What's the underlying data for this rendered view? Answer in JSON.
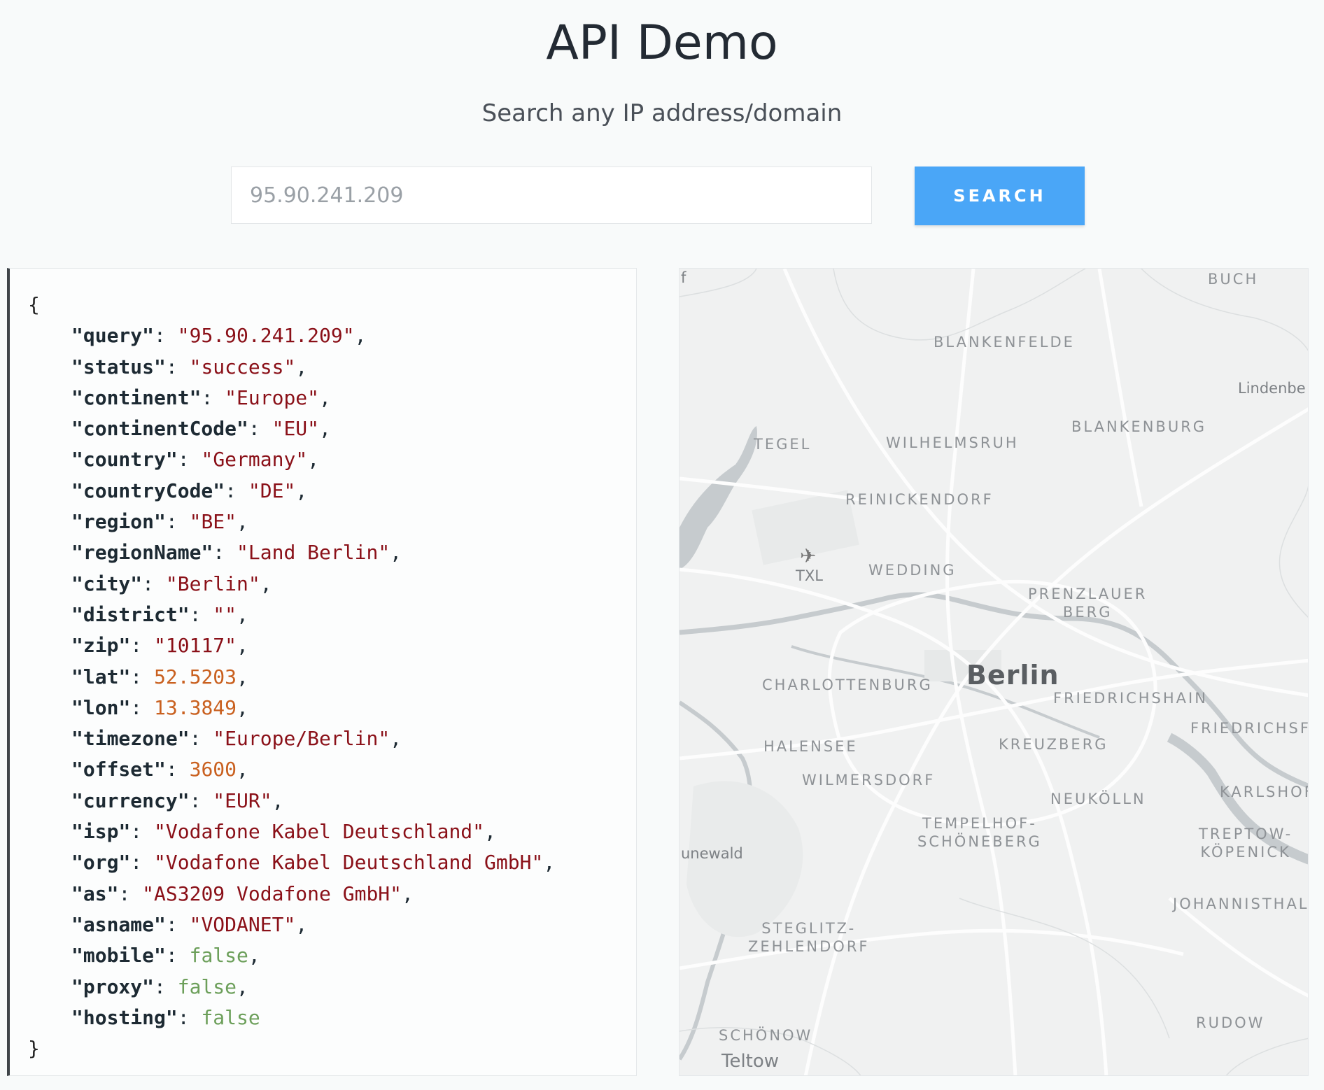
{
  "header": {
    "title": "API Demo",
    "subtitle": "Search any IP address/domain"
  },
  "search": {
    "value": "95.90.241.209",
    "button_label": "SEARCH",
    "button_color": "#4aa6f7"
  },
  "json_panel": {
    "open_brace": "{",
    "close_brace": "}",
    "fields": [
      {
        "key": "query",
        "value": "95.90.241.209",
        "type": "string"
      },
      {
        "key": "status",
        "value": "success",
        "type": "string"
      },
      {
        "key": "continent",
        "value": "Europe",
        "type": "string"
      },
      {
        "key": "continentCode",
        "value": "EU",
        "type": "string"
      },
      {
        "key": "country",
        "value": "Germany",
        "type": "string"
      },
      {
        "key": "countryCode",
        "value": "DE",
        "type": "string"
      },
      {
        "key": "region",
        "value": "BE",
        "type": "string"
      },
      {
        "key": "regionName",
        "value": "Land Berlin",
        "type": "string"
      },
      {
        "key": "city",
        "value": "Berlin",
        "type": "string"
      },
      {
        "key": "district",
        "value": "",
        "type": "string"
      },
      {
        "key": "zip",
        "value": "10117",
        "type": "string"
      },
      {
        "key": "lat",
        "value": "52.5203",
        "type": "number"
      },
      {
        "key": "lon",
        "value": "13.3849",
        "type": "number"
      },
      {
        "key": "timezone",
        "value": "Europe/Berlin",
        "type": "string"
      },
      {
        "key": "offset",
        "value": "3600",
        "type": "number"
      },
      {
        "key": "currency",
        "value": "EUR",
        "type": "string"
      },
      {
        "key": "isp",
        "value": "Vodafone Kabel Deutschland",
        "type": "string"
      },
      {
        "key": "org",
        "value": "Vodafone Kabel Deutschland GmbH",
        "type": "string"
      },
      {
        "key": "as",
        "value": "AS3209 Vodafone GmbH",
        "type": "string"
      },
      {
        "key": "asname",
        "value": "VODANET",
        "type": "string"
      },
      {
        "key": "mobile",
        "value": "false",
        "type": "bool"
      },
      {
        "key": "proxy",
        "value": "false",
        "type": "bool"
      },
      {
        "key": "hosting",
        "value": "false",
        "type": "bool"
      }
    ]
  },
  "map": {
    "city_label": "Berlin",
    "airport_label": "TXL",
    "airport_icon": "airplane-icon",
    "labels": [
      "BUCH",
      "BLANKENFELDE",
      "Lindenbe",
      "BLANKENBURG",
      "TEGEL",
      "WILHELMSRUH",
      "REINICKENDORF",
      "WEDDING",
      "PRENZLAUER\nBERG",
      "CHARLOTTENBURG",
      "FRIEDRICHSHAIN",
      "FRIEDRICHSF",
      "HALENSEE",
      "KREUZBERG",
      "WILMERSDORF",
      "NEUKÖLLN",
      "KARLSHOF",
      "TEMPELHOF-\nSCHÖNEBERG",
      "TREPTOW-\nKÖPENICK",
      "unewald",
      "JOHANNISTHAL",
      "STEGLITZ-\nZEHLENDORF",
      "RUDOW",
      "SCHÖNOW",
      "Teltow",
      "f"
    ]
  },
  "colors": {
    "json_key": "#1d2a33",
    "json_string": "#8a1018",
    "json_number": "#c9601f",
    "json_bool": "#6c9f5a",
    "page_bg": "#f8fafa",
    "map_bg": "#f0f1f1",
    "water": "#c6cbce"
  }
}
